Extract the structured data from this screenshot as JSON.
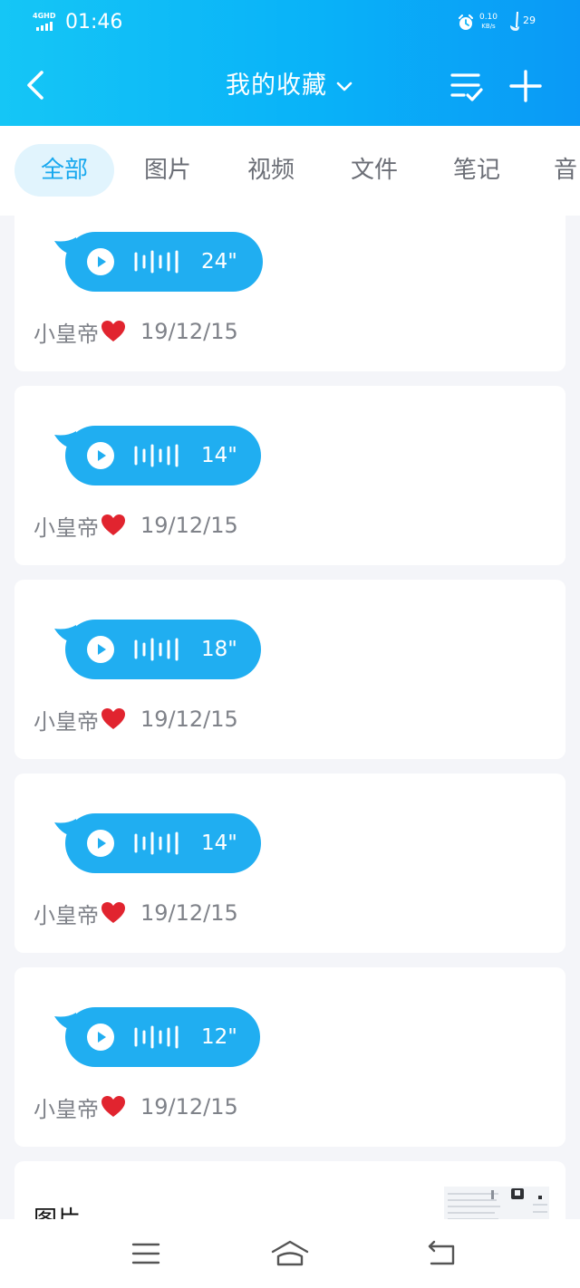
{
  "status_bar": {
    "network": "4GHD",
    "time": "01:46",
    "speed_value": "0.10",
    "speed_unit": "KB/s",
    "battery_level": "29"
  },
  "header": {
    "title": "我的收藏",
    "icons": [
      "back-arrow-icon",
      "chevron-down-icon",
      "select-list-icon",
      "add-icon"
    ]
  },
  "tabs": [
    {
      "label": "全部",
      "active": true
    },
    {
      "label": "图片",
      "active": false
    },
    {
      "label": "视频",
      "active": false
    },
    {
      "label": "文件",
      "active": false
    },
    {
      "label": "笔记",
      "active": false
    },
    {
      "label": "音",
      "active": false
    }
  ],
  "items": [
    {
      "duration": "24\"",
      "author": "小皇帝",
      "date": "19/12/15"
    },
    {
      "duration": "14\"",
      "author": "小皇帝",
      "date": "19/12/15"
    },
    {
      "duration": "18\"",
      "author": "小皇帝",
      "date": "19/12/15"
    },
    {
      "duration": "14\"",
      "author": "小皇帝",
      "date": "19/12/15"
    },
    {
      "duration": "12\"",
      "author": "小皇帝",
      "date": "19/12/15"
    }
  ],
  "image_card": {
    "title": "图片"
  },
  "nav": [
    "menu-icon",
    "home-icon",
    "back-icon"
  ],
  "colors": {
    "accent": "#09b2f8",
    "bubble": "#20aef1",
    "tab_active_bg": "#e1f4fd",
    "tab_active_text": "#18a8ee"
  }
}
